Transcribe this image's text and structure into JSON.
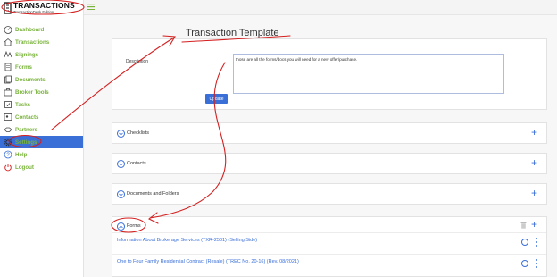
{
  "app": {
    "name": "TRANSACTIONS",
    "edition": "TransactionDesk Edition"
  },
  "sidebar": {
    "items": [
      {
        "label": "Dashboard",
        "icon": "dashboard-icon"
      },
      {
        "label": "Transactions",
        "icon": "house-icon"
      },
      {
        "label": "Signings",
        "icon": "signature-icon"
      },
      {
        "label": "Forms",
        "icon": "forms-icon"
      },
      {
        "label": "Documents",
        "icon": "documents-icon"
      },
      {
        "label": "Broker Tools",
        "icon": "broker-tools-icon"
      },
      {
        "label": "Tasks",
        "icon": "tasks-icon"
      },
      {
        "label": "Contacts",
        "icon": "contacts-icon"
      },
      {
        "label": "Partners",
        "icon": "partners-icon"
      },
      {
        "label": "Settings",
        "icon": "gear-icon",
        "active": true
      },
      {
        "label": "Help",
        "icon": "help-icon"
      },
      {
        "label": "Logout",
        "icon": "power-icon"
      }
    ]
  },
  "page": {
    "title": "Transaction Template"
  },
  "template_form": {
    "description_label": "Description",
    "description_value": "those are all the forms/docs you will need for a new offer/purchase.",
    "update_label": "Update"
  },
  "sections": [
    {
      "title": "Checklists"
    },
    {
      "title": "Contacts"
    },
    {
      "title": "Documents and Folders"
    }
  ],
  "forms_section": {
    "title": "Forms",
    "rows": [
      {
        "label": "Information About Brokerage Services (TXR-2501) (Selling Side)"
      },
      {
        "label": "One to Four Family Residential Contract (Resale) (TREC No. 20-16) (Rev. 08/2021)"
      }
    ]
  },
  "colors": {
    "accent": "#3a6fd8",
    "nav_text": "#7ab33b",
    "annotation": "#d42020"
  }
}
